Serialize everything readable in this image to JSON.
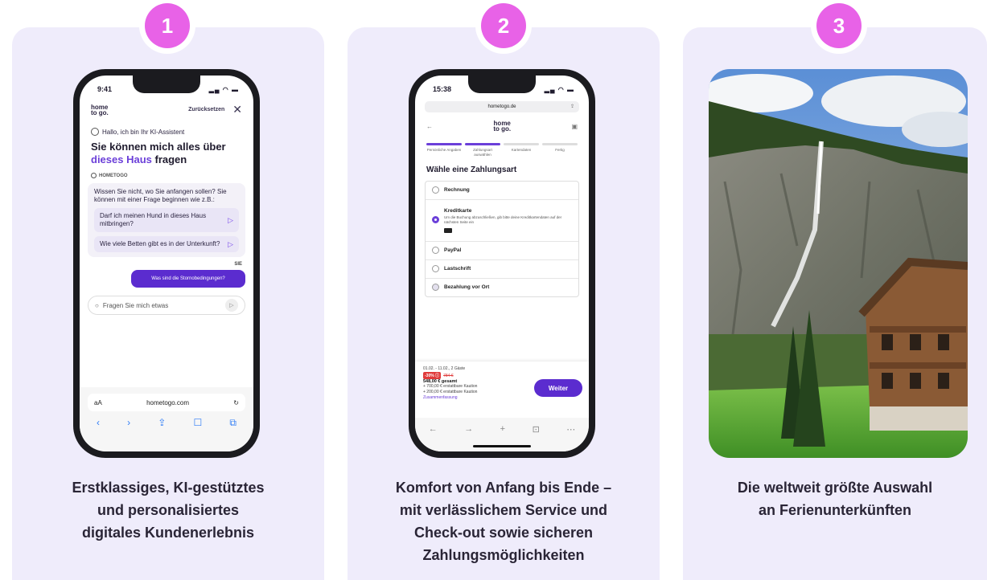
{
  "steps": [
    {
      "number": "1",
      "caption": [
        "Erstklassiges, KI-gestütztes",
        "und personalisiertes",
        "digitales Kundenerlebnis"
      ]
    },
    {
      "number": "2",
      "caption": [
        "Komfort von Anfang bis Ende –",
        "mit verlässlichem Service und",
        "Check-out sowie sicheren",
        "Zahlungsmöglichkeiten"
      ]
    },
    {
      "number": "3",
      "caption": [
        "Die weltweit größte Auswahl",
        "an Ferienunterkünften"
      ]
    }
  ],
  "phone1": {
    "time": "9:41",
    "logo": [
      "home",
      "to go."
    ],
    "reset_label": "Zurücksetzen",
    "close_glyph": "✕",
    "assistant_intro": "Hallo, ich bin Ihr KI-Assistent",
    "headline_1": "Sie können mich alles über",
    "headline_highlight": "dieses Haus",
    "headline_2": "fragen",
    "brand_label": "HOMETOGO",
    "bubble_text": "Wissen Sie nicht, wo Sie anfangen sollen? Sie können mit einer Frage beginnen wie z.B.:",
    "suggestions": [
      "Darf ich meinen Hund in dieses Haus mitbringen?",
      "Wie viele Betten gibt es in der Unterkunft?"
    ],
    "user_label": "SIE",
    "user_message": "Was sind die Stornobedingungen?",
    "input_placeholder": "Fragen Sie mich etwas",
    "safari_aa": "aA",
    "safari_url": "hometogo.com",
    "toolbar_icons": [
      "‹",
      "›",
      "⇪",
      "☐",
      "⧉"
    ]
  },
  "phone2": {
    "time": "15:38",
    "url": "hometogo.de",
    "logo": [
      "home",
      "to go."
    ],
    "step_labels": [
      "Persönliche Angaben",
      "Zahlungsart auswählen",
      "Kartendaten",
      "Fertig"
    ],
    "title": "Wähle eine Zahlungsart",
    "options": [
      {
        "label": "Rechnung",
        "desc": ""
      },
      {
        "label": "Kreditkarte",
        "desc": "Um die Buchung abzuschließen, gib bitte deine Kreditkartendaten auf der nächsten Seite ein"
      },
      {
        "label": "PayPal",
        "desc": ""
      },
      {
        "label": "Lastschrift",
        "desc": ""
      },
      {
        "label": "Bezahlung vor Ort",
        "desc": ""
      }
    ],
    "dates": "01.02. - 11.02., 2 Gäste",
    "discount": "-30% ⓘ",
    "old_price": "784 €",
    "total": "548,00 € gesamt",
    "deposit_1": "+ 700,00 € erstattbare Kaution",
    "deposit_2": "+ 200,00 € erstattbare Kaution",
    "summary_link": "Zusammenfassung",
    "cta": "Weiter",
    "toolbar_icons": [
      "←",
      "→",
      "+",
      "⊡",
      "⋯"
    ]
  },
  "colors": {
    "accent": "#e862e7",
    "brand": "#5b2ccf",
    "card_bg": "#efecfb"
  }
}
